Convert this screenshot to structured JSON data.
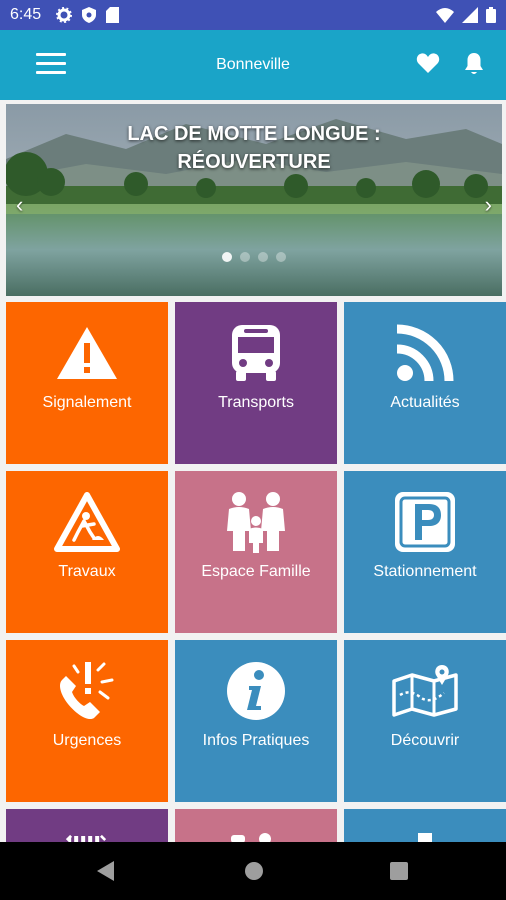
{
  "status_bar": {
    "time": "6:45"
  },
  "app_bar": {
    "title": "Bonneville"
  },
  "banner": {
    "title_line1": "LAC DE MOTTE LONGUE :",
    "title_line2": "RÉOUVERTURE",
    "slide_count": 4,
    "active_slide": 1
  },
  "tiles": [
    {
      "label": "Signalement",
      "icon": "warning-icon",
      "color": "#fd6600"
    },
    {
      "label": "Transports",
      "icon": "bus-icon",
      "color": "#713c83"
    },
    {
      "label": "Actualités",
      "icon": "rss-icon",
      "color": "#3b8dbd"
    },
    {
      "label": "Travaux",
      "icon": "roadworks-icon",
      "color": "#fd6600"
    },
    {
      "label": "Espace Famille",
      "icon": "family-icon",
      "color": "#c77289"
    },
    {
      "label": "Stationnement",
      "icon": "parking-icon",
      "color": "#3b8dbd"
    },
    {
      "label": "Urgences",
      "icon": "phone-alert-icon",
      "color": "#fd6600"
    },
    {
      "label": "Infos Pratiques",
      "icon": "info-icon",
      "color": "#3b8dbd"
    },
    {
      "label": "Découvrir",
      "icon": "map-icon",
      "color": "#3b8dbd"
    }
  ],
  "colors": {
    "status_bar": "#3f51b5",
    "app_bar": "#1aa4c8"
  }
}
